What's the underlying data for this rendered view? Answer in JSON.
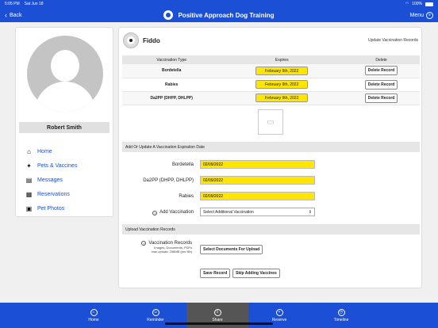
{
  "status": {
    "time": "5:05 PM",
    "date": "Sat Jun 18",
    "battery": "100%"
  },
  "nav": {
    "back_label": "Back",
    "title": "Positive Approach Dog Training",
    "menu_label": "Menu"
  },
  "user": {
    "name": "Robert Smith"
  },
  "sidebar": {
    "items": [
      {
        "label": "Home",
        "icon": "home-icon"
      },
      {
        "label": "Pets & Vaccines",
        "icon": "paw-icon"
      },
      {
        "label": "Messages",
        "icon": "message-icon"
      },
      {
        "label": "Reservations",
        "icon": "calendar-icon"
      },
      {
        "label": "Pet Photos",
        "icon": "photo-icon"
      }
    ]
  },
  "pet": {
    "name": "Fiddo",
    "section_title": "Update Vaccination Records"
  },
  "table": {
    "headers": [
      "Vaccination Type",
      "Expires",
      "Delete"
    ],
    "rows": [
      {
        "type": "Bordetella",
        "expires": "February 9th, 2022",
        "action": "Delete Record"
      },
      {
        "type": "Rabies",
        "expires": "February 9th, 2022",
        "action": "Delete Record"
      },
      {
        "type": "Da2PP (DHPP, DHLPP)",
        "expires": "February 9th, 2022",
        "action": "Delete Record"
      }
    ]
  },
  "form": {
    "section_title": "Add Or Update A Vaccination Expiration Date",
    "fields": [
      {
        "label": "Bordetella",
        "value": "02/09/2022"
      },
      {
        "label": "Da2PP (DHPP, DHLPP)",
        "value": "02/09/2022"
      },
      {
        "label": "Rabies",
        "value": "02/09/2022"
      }
    ],
    "add_label": "Add Vaccination",
    "select_value": "Select Additional Vaccination"
  },
  "upload": {
    "section_title": "Upload Vaccination Records",
    "label": "Vaccination Records",
    "sub1": "Images, Documents, PDFs",
    "sub2": "max upload: 256MB (per file)",
    "button": "Select Documents For Upload"
  },
  "actions": {
    "save": "Save Record",
    "skip": "Skip Adding Vaccines"
  },
  "tabs": [
    {
      "label": "Home",
      "icon": "home-tab-icon"
    },
    {
      "label": "Reminder",
      "icon": "reminder-icon"
    },
    {
      "label": "Share",
      "icon": "share-icon"
    },
    {
      "label": "Reserve",
      "icon": "plus-icon"
    },
    {
      "label": "Timeline",
      "icon": "clock-icon"
    }
  ],
  "colors": {
    "accent": "#1a4fd6",
    "highlight": "#ffe500"
  }
}
